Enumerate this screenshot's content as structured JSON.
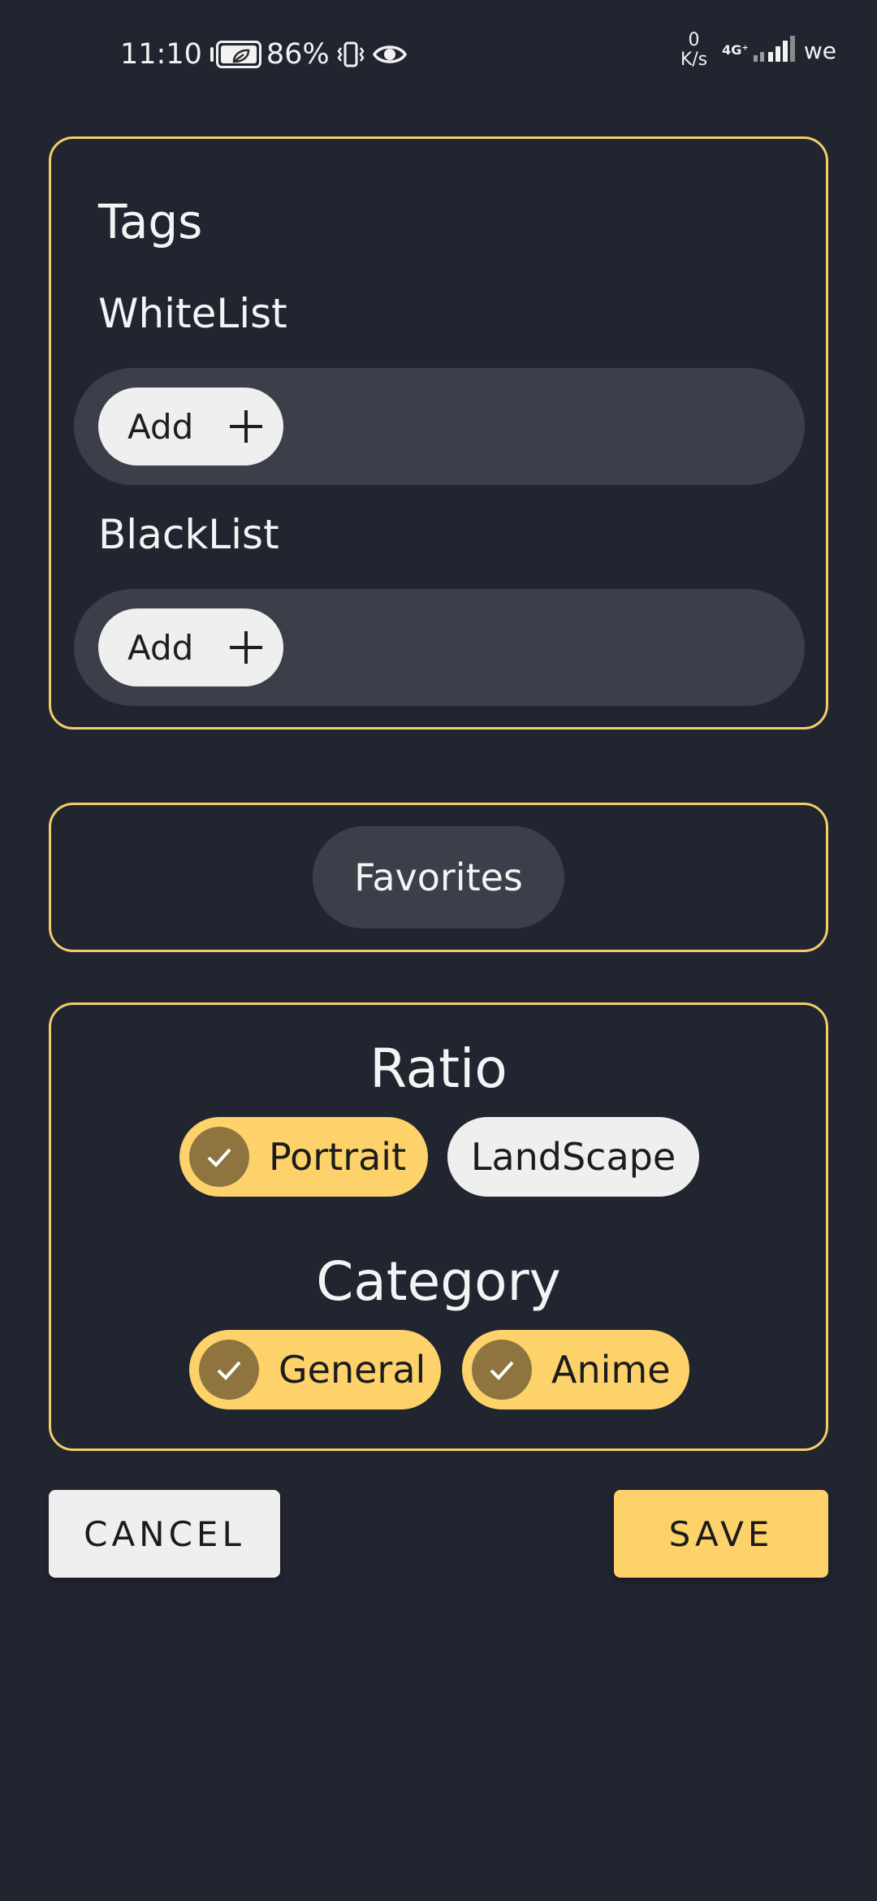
{
  "status_bar": {
    "time": "11:10",
    "battery_percent": "86%",
    "net_speed_value": "0",
    "net_speed_unit": "K/s",
    "network_type": "4G⁺",
    "carrier": "we"
  },
  "tags": {
    "title": "Tags",
    "whitelist": {
      "label": "WhiteList",
      "add_label": "Add"
    },
    "blacklist": {
      "label": "BlackList",
      "add_label": "Add"
    }
  },
  "favorites": {
    "label": "Favorites"
  },
  "ratio": {
    "title": "Ratio",
    "options": [
      {
        "label": "Portrait",
        "selected": true
      },
      {
        "label": "LandScape",
        "selected": false
      }
    ]
  },
  "category": {
    "title": "Category",
    "options": [
      {
        "label": "General",
        "selected": true
      },
      {
        "label": "Anime",
        "selected": true
      }
    ]
  },
  "actions": {
    "cancel_label": "CANCEL",
    "save_label": "SAVE"
  },
  "colors": {
    "background": "#212530",
    "accent": "#fdd26a",
    "card_border": "#f3cd6a",
    "track": "#3b3f49",
    "check_circle": "#8e7540"
  }
}
